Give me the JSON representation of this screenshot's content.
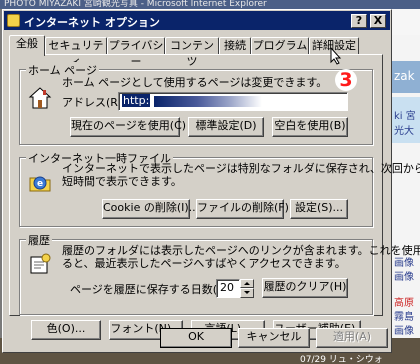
{
  "background_window": {
    "title": "PHOTO MIYAZAKI 宮崎観光写真 - Microsoft Internet Explorer",
    "side_items": [
      "zak",
      "ki 宮",
      "光大",
      "画像",
      "画像",
      "高原",
      "霧島",
      "画像"
    ],
    "caption": "07/29 リュ・シウォ"
  },
  "dialog": {
    "title": "インターネット オプション",
    "help_glyph": "?",
    "close_glyph": "X"
  },
  "tabs": [
    {
      "label": "全般",
      "active": true
    },
    {
      "label": "セキュリティ",
      "active": false
    },
    {
      "label": "プライバシー",
      "active": false
    },
    {
      "label": "コンテンツ",
      "active": false
    },
    {
      "label": "接続",
      "active": false
    },
    {
      "label": "プログラム",
      "active": false
    },
    {
      "label": "詳細設定",
      "active": false
    }
  ],
  "home_page": {
    "title": "ホーム ページ",
    "description": "ホーム ページとして使用するページは変更できます。",
    "address_label": "アドレス(R):",
    "address_value": "http:",
    "buttons": {
      "use_current": "現在のページを使用(C)",
      "use_default": "標準設定(D)",
      "use_blank": "空白を使用(B)"
    },
    "icon": "house-icon"
  },
  "temp_files": {
    "title": "インターネット一時ファイル",
    "description_line1": "インターネットで表示したページは特別なフォルダに保存され、次回からは",
    "description_line2": "短時間で表示できます。",
    "buttons": {
      "delete_cookies": "Cookie の削除(I)...",
      "delete_files": "ファイルの削除(F)...",
      "settings": "設定(S)..."
    },
    "icon": "ie-folder-icon"
  },
  "history": {
    "title": "履歴",
    "description_line1": "履歴のフォルダには表示したページへのリンクが含まれます。これを使用す",
    "description_line2": "ると、最近表示したページへすばやくアクセスできます。",
    "days_label": "ページを履歴に保存する日数(K):",
    "days_value": "20",
    "clear_button": "履歴のクリア(H)",
    "icon": "history-icon"
  },
  "bottom_buttons": {
    "colors": "色(O)...",
    "fonts": "フォント(N)...",
    "languages": "言語(L)...",
    "accessibility": "ユーザー補助(E)..."
  },
  "dialog_buttons": {
    "ok": "OK",
    "cancel": "キャンセル",
    "apply": "適用(A)"
  },
  "annotation": {
    "step_number": "3"
  },
  "colors": {
    "titlebar": "#0a246a",
    "dialog_face": "#d4d0c8",
    "annotation_red": "#ff1a1a"
  }
}
